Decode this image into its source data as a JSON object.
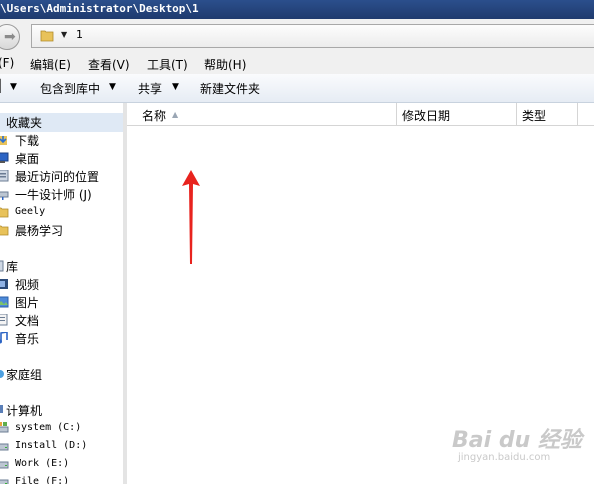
{
  "window": {
    "title": "\\Users\\Administrator\\Desktop\\1"
  },
  "address": {
    "segment": "1"
  },
  "menu": {
    "file": "(F)",
    "edit": "编辑(E)",
    "view": "查看(V)",
    "tools": "工具(T)",
    "help": "帮助(H)"
  },
  "toolbar": {
    "organize_partial": "▌",
    "include_library": "包含到库中",
    "share": "共享",
    "new_folder": "新建文件夹"
  },
  "sidebar": {
    "favorites": "收藏夹",
    "fav_items": [
      "下载",
      "桌面",
      "最近访问的位置",
      "一牛设计师 (J)",
      "Geely",
      "晨杨学习"
    ],
    "libraries": "库",
    "lib_items": [
      "视频",
      "图片",
      "文档",
      "音乐"
    ],
    "homegroup": "家庭组",
    "computer": "计算机",
    "drives": [
      "system (C:)",
      "Install (D:)",
      "Work (E:)",
      "File (F:)"
    ]
  },
  "columns": {
    "name": "名称",
    "date": "修改日期",
    "type": "类型"
  },
  "watermark": {
    "brand": "Bai du 经验",
    "url": "jingyan.baidu.com"
  },
  "colors": {
    "titlebar": "#2b4f8c",
    "arrow": "#e8231e",
    "selection": "#dfe9f5"
  }
}
